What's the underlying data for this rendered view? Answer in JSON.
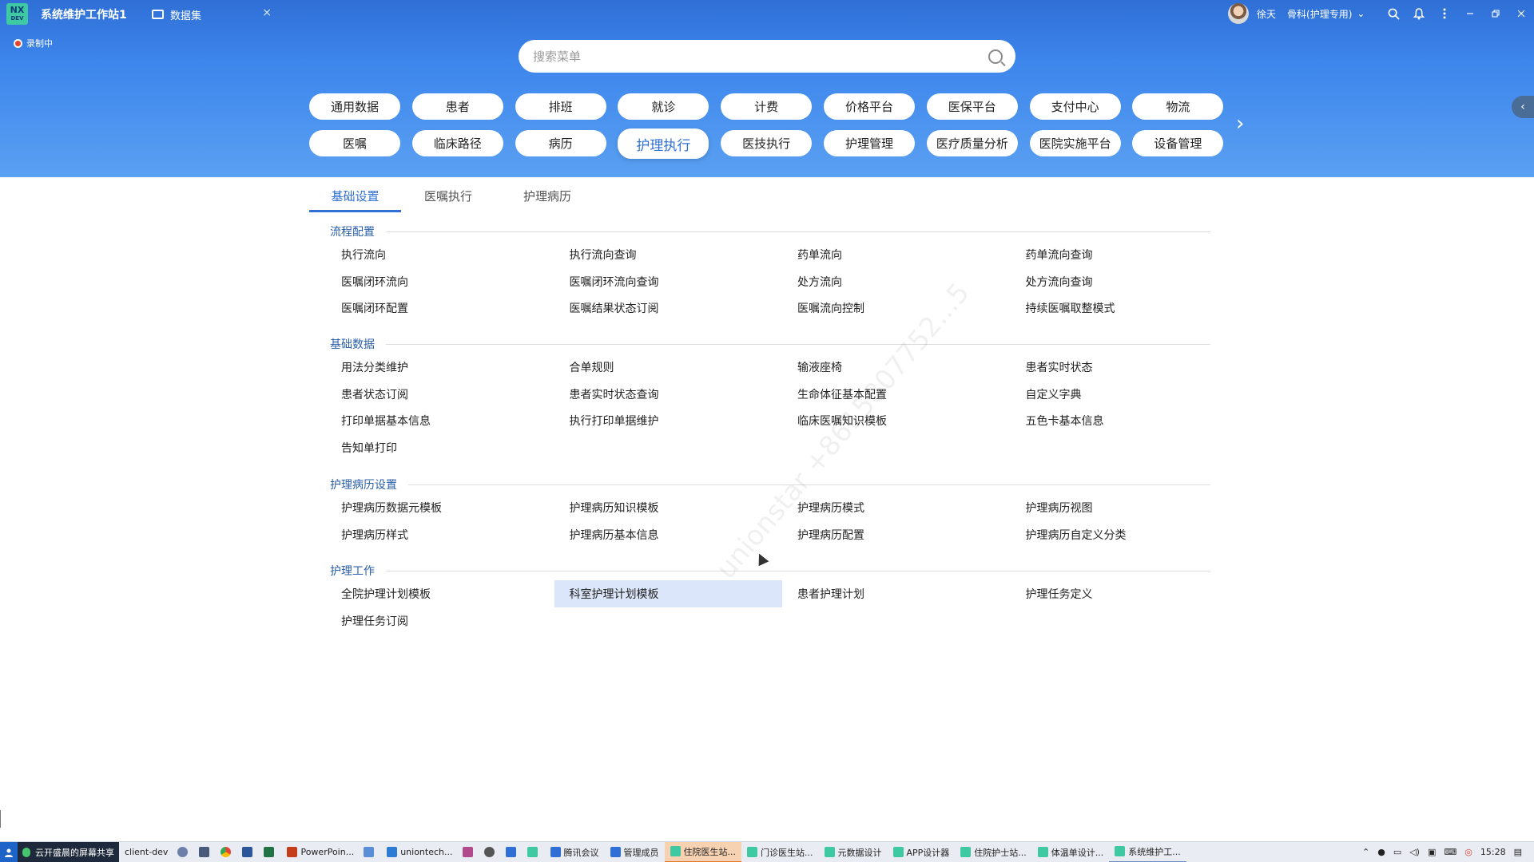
{
  "app": {
    "logo_text": "NX",
    "logo_sub": "DEV",
    "title": "系统维护工作站1"
  },
  "document_tab": {
    "label": "数据集",
    "close": "×"
  },
  "user": {
    "name": "徐天",
    "department": "骨科(护理专用)",
    "chevron": "⌄"
  },
  "window_icons": [
    "search-icon",
    "bell-icon",
    "more-icon",
    "minimize-icon",
    "restore-icon",
    "close-icon"
  ],
  "recording": {
    "label": "录制中"
  },
  "search": {
    "placeholder": "搜索菜单",
    "value": ""
  },
  "modules": [
    {
      "label": "通用数据"
    },
    {
      "label": "患者"
    },
    {
      "label": "排班"
    },
    {
      "label": "就诊"
    },
    {
      "label": "计费"
    },
    {
      "label": "价格平台"
    },
    {
      "label": "医保平台"
    },
    {
      "label": "支付中心"
    },
    {
      "label": "物流"
    },
    {
      "label": "医嘱"
    },
    {
      "label": "临床路径"
    },
    {
      "label": "病历"
    },
    {
      "label": "护理执行",
      "active": true
    },
    {
      "label": "医技执行"
    },
    {
      "label": "护理管理"
    },
    {
      "label": "医疗质量分析"
    },
    {
      "label": "医院实施平台"
    },
    {
      "label": "设备管理"
    }
  ],
  "module_next": "›",
  "side_toggle": "‹",
  "subtabs": [
    {
      "label": "基础设置",
      "active": true
    },
    {
      "label": "医嘱执行"
    },
    {
      "label": "护理病历"
    }
  ],
  "sections": [
    {
      "title": "流程配置",
      "items": [
        "执行流向",
        "执行流向查询",
        "药单流向",
        "药单流向查询",
        "医嘱闭环流向",
        "医嘱闭环流向查询",
        "处方流向",
        "处方流向查询",
        "医嘱闭环配置",
        "医嘱结果状态订阅",
        "医嘱流向控制",
        "持续医嘱取整模式"
      ]
    },
    {
      "title": "基础数据",
      "items": [
        "用法分类维护",
        "合单规则",
        "输液座椅",
        "患者实时状态",
        "患者状态订阅",
        "患者实时状态查询",
        "生命体征基本配置",
        "自定义字典",
        "打印单据基本信息",
        "执行打印单据维护",
        "临床医嘱知识模板",
        "五色卡基本信息",
        "告知单打印"
      ]
    },
    {
      "title": "护理病历设置",
      "items": [
        "护理病历数据元模板",
        "护理病历知识模板",
        "护理病历模式",
        "护理病历视图",
        "护理病历样式",
        "护理病历基本信息",
        "护理病历配置",
        "护理病历自定义分类"
      ]
    },
    {
      "title": "护理工作",
      "items": [
        "全院护理计划模板",
        "科室护理计划模板",
        "患者护理计划",
        "护理任务定义",
        "护理任务订阅"
      ],
      "hovered_index": 1
    }
  ],
  "watermark": "unionstar +8615807752...5",
  "taskbar": {
    "share_label": "云开盛晨的屏幕共享",
    "tasks": [
      {
        "label": "client-dev",
        "color": "#444444"
      },
      {
        "label": "",
        "color": "#6b7fa8"
      },
      {
        "label": "",
        "color": "#4a5a7a"
      },
      {
        "label": "",
        "color": "#e8a317"
      },
      {
        "label": "",
        "color": "#2b579a"
      },
      {
        "label": "",
        "color": "#217346"
      },
      {
        "label": "PowerPoin...",
        "color": "#c43e1c"
      },
      {
        "label": "",
        "color": "#5a8fd8"
      },
      {
        "label": "uniontech...",
        "color": "#2e7bd6"
      },
      {
        "label": "",
        "color": "#b04a8a"
      },
      {
        "label": "",
        "color": "#555555"
      },
      {
        "label": "",
        "color": "#2f6fd6"
      },
      {
        "label": "",
        "color": "#3ec9a3"
      },
      {
        "label": "腾讯会议",
        "color": "#2f6fd6"
      },
      {
        "label": "管理成员",
        "color": "#2f6fd6"
      },
      {
        "label": "住院医生站...",
        "color": "#3ec9a3",
        "active": true
      },
      {
        "label": "门诊医生站...",
        "color": "#3ec9a3"
      },
      {
        "label": "元数据设计",
        "color": "#3ec9a3"
      },
      {
        "label": "APP设计器",
        "color": "#3ec9a3"
      },
      {
        "label": "住院护士站...",
        "color": "#3ec9a3"
      },
      {
        "label": "体温单设计...",
        "color": "#3ec9a3"
      },
      {
        "label": "系统维护工...",
        "color": "#3ec9a3",
        "open": true
      }
    ],
    "time": "15:28"
  }
}
